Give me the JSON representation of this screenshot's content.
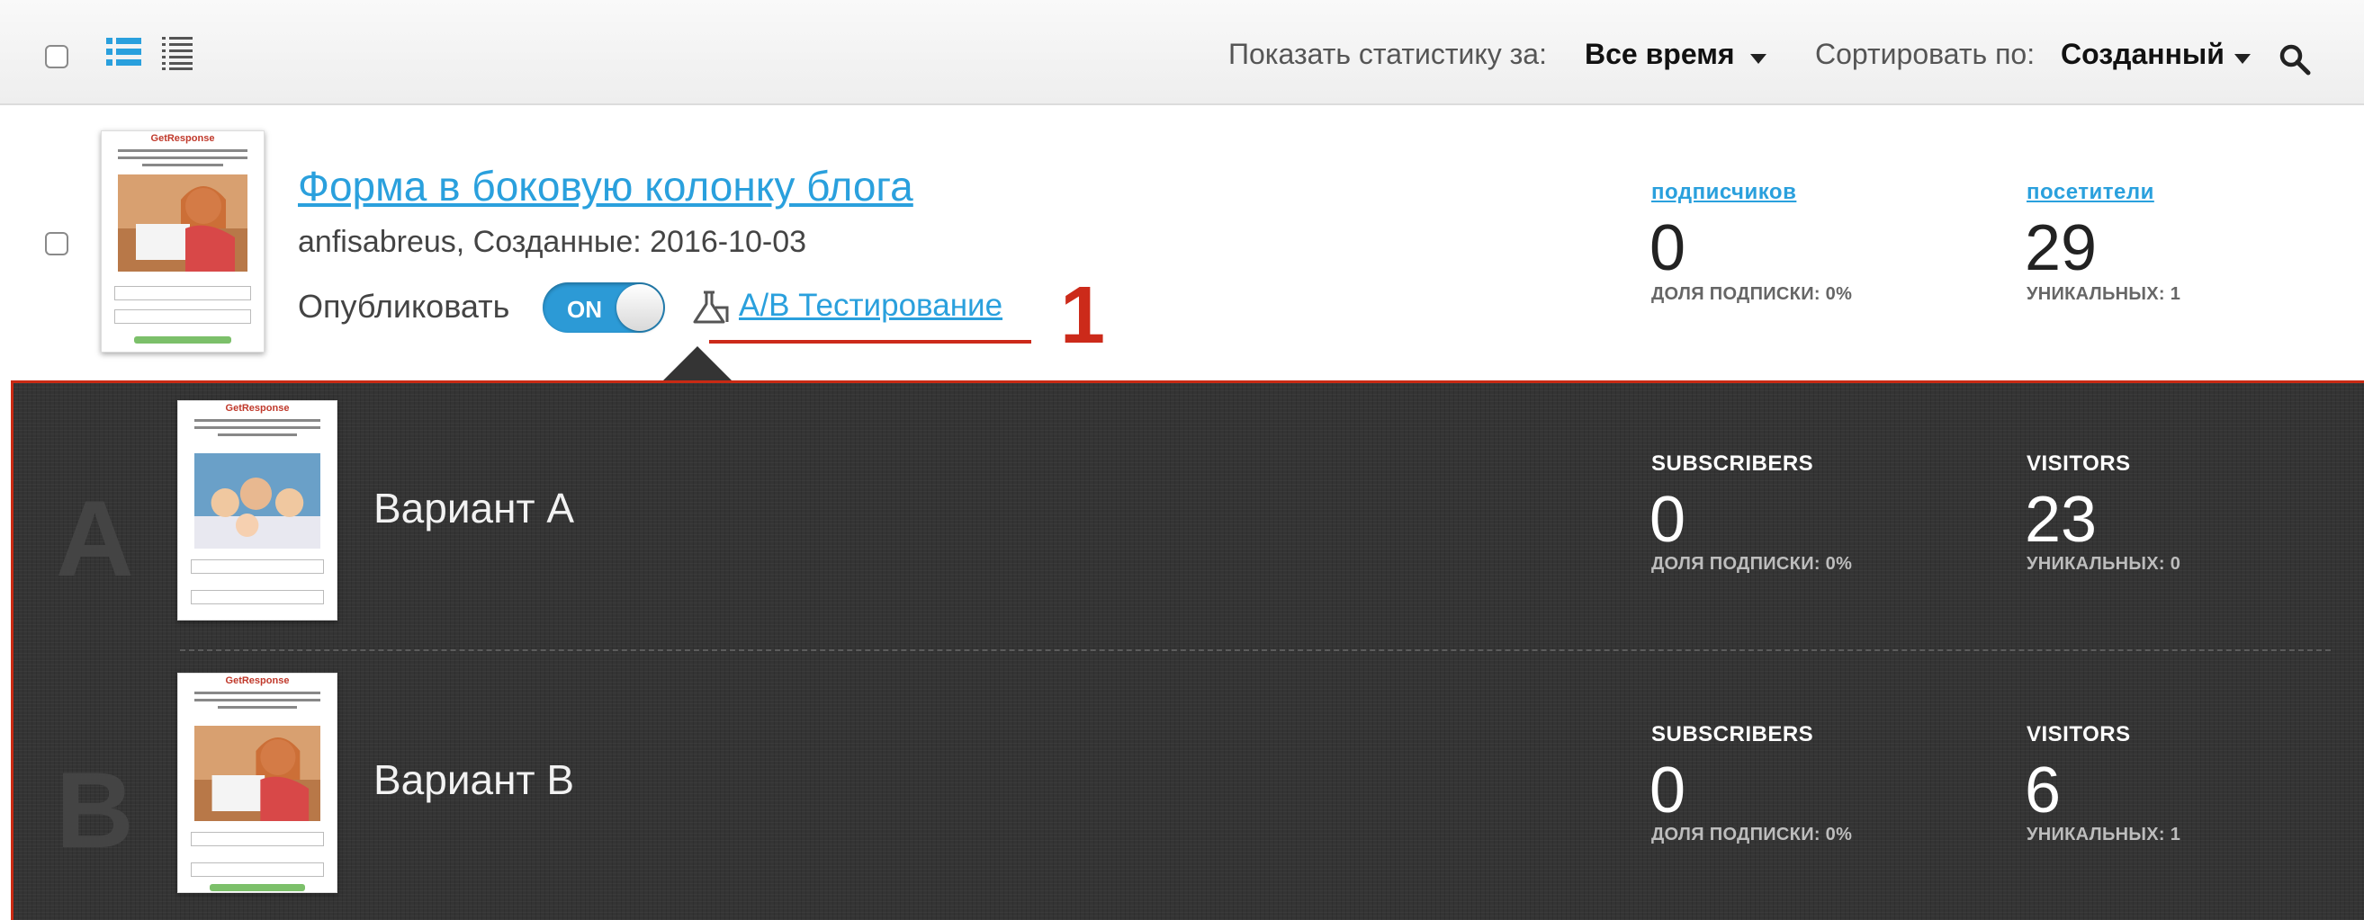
{
  "toolbar": {
    "stats_label": "Показать статистику за:",
    "stats_value": "Все время",
    "sort_label": "Сортировать по:",
    "sort_value": "Созданный"
  },
  "form": {
    "title": "Форма в боковую колонку блога",
    "meta": "anfisabreus, Созданные: 2016-10-03",
    "publish_label": "Опубликовать",
    "toggle_state": "ON",
    "ab_label": "A/B Тестирование",
    "annotation": "1",
    "subscribers_label": "подписчиков",
    "subscribers_value": "0",
    "subscribers_sub": "ДОЛЯ ПОДПИСКИ: 0%",
    "visitors_label": "посетители",
    "visitors_value": "29",
    "visitors_sub": "УНИКАЛЬНЫХ: 1"
  },
  "variants": [
    {
      "letter": "A",
      "name": "Вариант А",
      "subscribers_label": "SUBSCRIBERS",
      "subscribers_value": "0",
      "subscribers_sub": "ДОЛЯ ПОДПИСКИ: 0%",
      "visitors_label": "VISITORS",
      "visitors_value": "23",
      "visitors_sub": "УНИКАЛЬНЫХ: 0"
    },
    {
      "letter": "B",
      "name": "Вариант В",
      "subscribers_label": "SUBSCRIBERS",
      "subscribers_value": "0",
      "subscribers_sub": "ДОЛЯ ПОДПИСКИ: 0%",
      "visitors_label": "VISITORS",
      "visitors_value": "6",
      "visitors_sub": "УНИКАЛЬНЫХ: 1"
    }
  ],
  "colors": {
    "link": "#2aa0dd",
    "toggle_on": "#2c9ad6",
    "annotation_red": "#cc2a1a",
    "panel_bg": "#343434"
  }
}
